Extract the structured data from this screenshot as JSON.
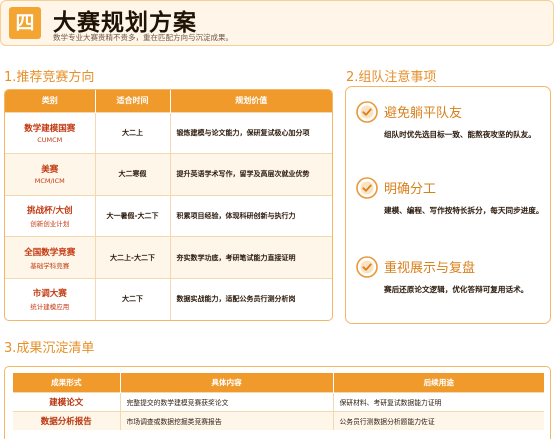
{
  "header": {
    "badge": "四",
    "title": "大赛规划方案",
    "subtitle": "数学专业大赛贵精不贵多，重在匹配方向与沉淀成果。"
  },
  "section1": {
    "heading": "1.推荐竞赛方向",
    "columns": [
      "类别",
      "适合时间",
      "规划价值"
    ],
    "rows": [
      {
        "name": "数学建模国赛",
        "sub": "CUMCM",
        "when": "大二上",
        "value": "锻炼建模与论文能力，保研复试极心加分项"
      },
      {
        "name": "美赛",
        "sub": "MCM/ICM",
        "when": "大二寒假",
        "value": "提升英语学术写作，留学及高层次就业优势"
      },
      {
        "name": "挑战杯/大创",
        "sub": "创新创业计划",
        "when": "大一暑假-大二下",
        "value": "积累项目经验，体现科研创新与执行力"
      },
      {
        "name": "全国数学竞赛",
        "sub": "基础学科竞赛",
        "when": "大二上-大二下",
        "value": "夯实数学功底，考研笔试能力直接证明"
      },
      {
        "name": "市调大赛",
        "sub": "统计建模应用",
        "when": "大二下",
        "value": "数据实战能力，适配公务员行测分析岗"
      }
    ]
  },
  "section2": {
    "heading": "2.组队注意事项",
    "tips": [
      {
        "title": "避免躺平队友",
        "body": "组队时优先选目标一致、能熬夜攻坚的队友。"
      },
      {
        "title": "明确分工",
        "body": "建模、编程、写作按特长拆分，每天同步进度。"
      },
      {
        "title": "重视展示与复盘",
        "body": "赛后还原论文逻辑，优化答辩可复用话术。"
      }
    ]
  },
  "section3": {
    "heading": "3.成果沉淀清单",
    "columns": [
      "成果形式",
      "具体内容",
      "后续用途"
    ],
    "rows": [
      {
        "form": "建模论文",
        "content": "完整提交的数学建模竞赛获奖论文",
        "use": "保研材料、考研复试数据能力证明"
      },
      {
        "form": "数据分析报告",
        "content": "市场调查或数据挖掘类竞赛报告",
        "use": "公务员行测数据分析题能力佐证"
      }
    ]
  },
  "colors": {
    "accent": "#f19a2c",
    "accent_dark": "#d9801c",
    "highlight_red": "#c23a12"
  },
  "icons": {
    "tip": "check-circle-icon"
  }
}
